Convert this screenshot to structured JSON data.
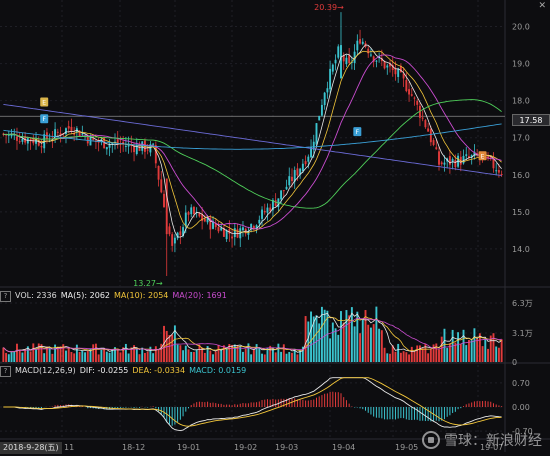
{
  "chart_data": [
    {
      "type": "candlestick",
      "ylim": [
        13.0,
        20.5
      ],
      "y_ticks": [
        "20.0",
        "19.0",
        "18.0",
        "17.0",
        "16.0",
        "15.0",
        "14.0"
      ],
      "x_tick_labels": [
        "11",
        "18-12",
        "19-01",
        "19-02",
        "19-03",
        "19-04",
        "19-05",
        "19-07"
      ],
      "current_price_label": "17.58",
      "annotations": {
        "high": "20.39",
        "low": "13.27"
      },
      "markers": [
        "E",
        "F",
        "F",
        "E"
      ],
      "colors": {
        "up": "#3bc4cf",
        "down": "#e23b3b",
        "ma5": "#e8e8e8",
        "ma10": "#f2c63a",
        "ma20": "#c94ccf",
        "ma60": "#4fcf5a",
        "ma120": "#3a9fd6",
        "ma250": "#6b6bd6"
      }
    },
    {
      "type": "bar",
      "title": "VOL",
      "legend": {
        "vol": "VOL: 2336",
        "ma5": "MA(5): 2062",
        "ma10": "MA(10): 2054",
        "ma20": "MA(20): 1691"
      },
      "y_ticks": [
        "6.3万",
        "3.1万",
        "0"
      ]
    },
    {
      "type": "macd",
      "legend": {
        "name": "MACD(12,26,9)",
        "dif": "DIF: -0.0255",
        "dea": "DEA: -0.0334",
        "macd": "MACD: 0.0159"
      },
      "y_ticks": [
        "0.70",
        "0.00",
        "-0.70"
      ]
    }
  ],
  "header": {
    "date_badge": "2018-9-28(五)"
  },
  "watermark": {
    "text": "雪球：新浪财经"
  }
}
